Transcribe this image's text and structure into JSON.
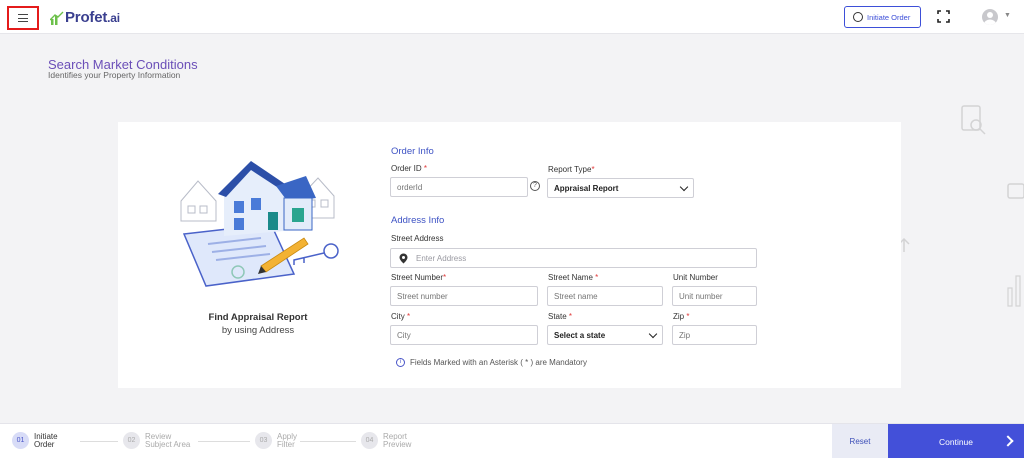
{
  "header": {
    "logo_text": "Profet",
    "logo_suffix": ".ai",
    "initiate_order_label": "Initiate Order"
  },
  "page": {
    "title": "Search Market Conditions",
    "subtitle": "Identifies your Property Information"
  },
  "illustration": {
    "title": "Find Appraisal Report",
    "subtitle": "by using Address"
  },
  "order_info": {
    "heading": "Order Info",
    "order_id_label": "Order ID",
    "order_id_placeholder": "orderId",
    "report_type_label": "Report Type",
    "report_type_value": "Appraisal Report"
  },
  "address_info": {
    "heading": "Address Info",
    "street_address_label": "Street Address",
    "street_address_placeholder": "Enter Address",
    "street_number_label": "Street Number",
    "street_number_placeholder": "Street number",
    "street_name_label": "Street Name",
    "street_name_placeholder": "Street name",
    "unit_number_label": "Unit Number",
    "unit_number_placeholder": "Unit number",
    "city_label": "City",
    "city_placeholder": "City",
    "state_label": "State",
    "state_value": "Select a state",
    "zip_label": "Zip",
    "zip_placeholder": "Zip"
  },
  "required_marker": "*",
  "mandatory_note": "Fields Marked with an Asterisk ( * ) are Mandatory",
  "stepper": {
    "steps": [
      {
        "num": "01",
        "line1": "Initiate",
        "line2": "Order",
        "active": true
      },
      {
        "num": "02",
        "line1": "Review",
        "line2": "Subject Area",
        "active": false
      },
      {
        "num": "03",
        "line1": "Apply",
        "line2": "Filter",
        "active": false
      },
      {
        "num": "04",
        "line1": "Report",
        "line2": "Preview",
        "active": false
      }
    ]
  },
  "footer": {
    "reset_label": "Reset",
    "continue_label": "Continue"
  },
  "colors": {
    "accent": "#4350d9",
    "title_purple": "#6b4fb8",
    "required_red": "#e03a3a",
    "menu_highlight": "#e41b1b"
  }
}
